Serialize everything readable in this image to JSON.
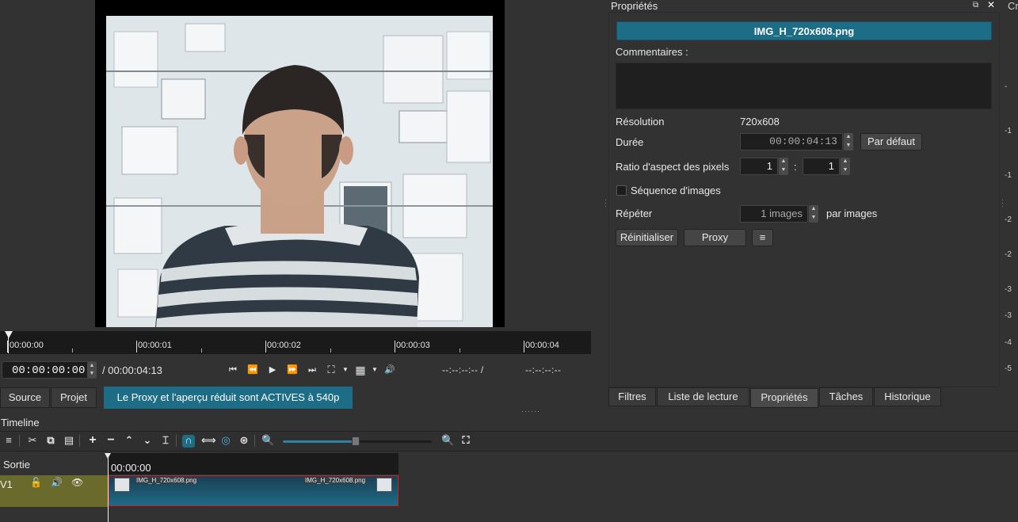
{
  "viewer": {
    "ruler_ticks": [
      "00:00:00",
      "00:00:01",
      "00:00:02",
      "00:00:03",
      "00:00:04"
    ]
  },
  "transport": {
    "timecode": "00:00:00:00",
    "total_duration": "/ 00:00:04:13",
    "in_point": "--:--:--:-- /",
    "out_point": "--:--:--:--"
  },
  "left_tabs": {
    "source": "Source",
    "projet": "Projet",
    "proxy_banner": "Le Proxy et l'aperçu réduit sont ACTIVES à 540p"
  },
  "properties": {
    "title": "Propriétés",
    "clip_name": "IMG_H_720x608.png",
    "comments_label": "Commentaires :",
    "resolution_label": "Résolution",
    "resolution_value": "720x608",
    "duration_label": "Durée",
    "duration_value": "00:00:04:13",
    "default_button": "Par défaut",
    "pixel_ratio_label": "Ratio d'aspect des pixels",
    "pixel_ratio_num": "1",
    "pixel_ratio_sep": ":",
    "pixel_ratio_den": "1",
    "image_sequence_label": "Séquence d'images",
    "repeat_label": "Répéter",
    "repeat_value": "1 images",
    "per_images_label": "par images",
    "reset_button": "Réinitialiser",
    "proxy_button": "Proxy",
    "menu_button": "≡"
  },
  "right_tabs": [
    "Filtres",
    "Liste de lecture",
    "Propriétés",
    "Tâches",
    "Historique"
  ],
  "right_edge": {
    "title_fragment": "Cr",
    "meter_labels": [
      "-",
      "-1",
      "-1",
      "-2",
      "-2",
      "-3",
      "-3",
      "-4",
      "-5"
    ]
  },
  "timeline": {
    "title": "Timeline",
    "output_label": "Sortie",
    "ruler_label": "00:00:00",
    "track_label": "V1",
    "clip_name_left": "IMG_H_720x608.png",
    "clip_name_right": "IMG_H_720x608.png",
    "zoom_level": 0.49
  },
  "colors": {
    "accent": "#1e6d86",
    "track": "#6a6a2c",
    "clip_border": "#d02020"
  }
}
